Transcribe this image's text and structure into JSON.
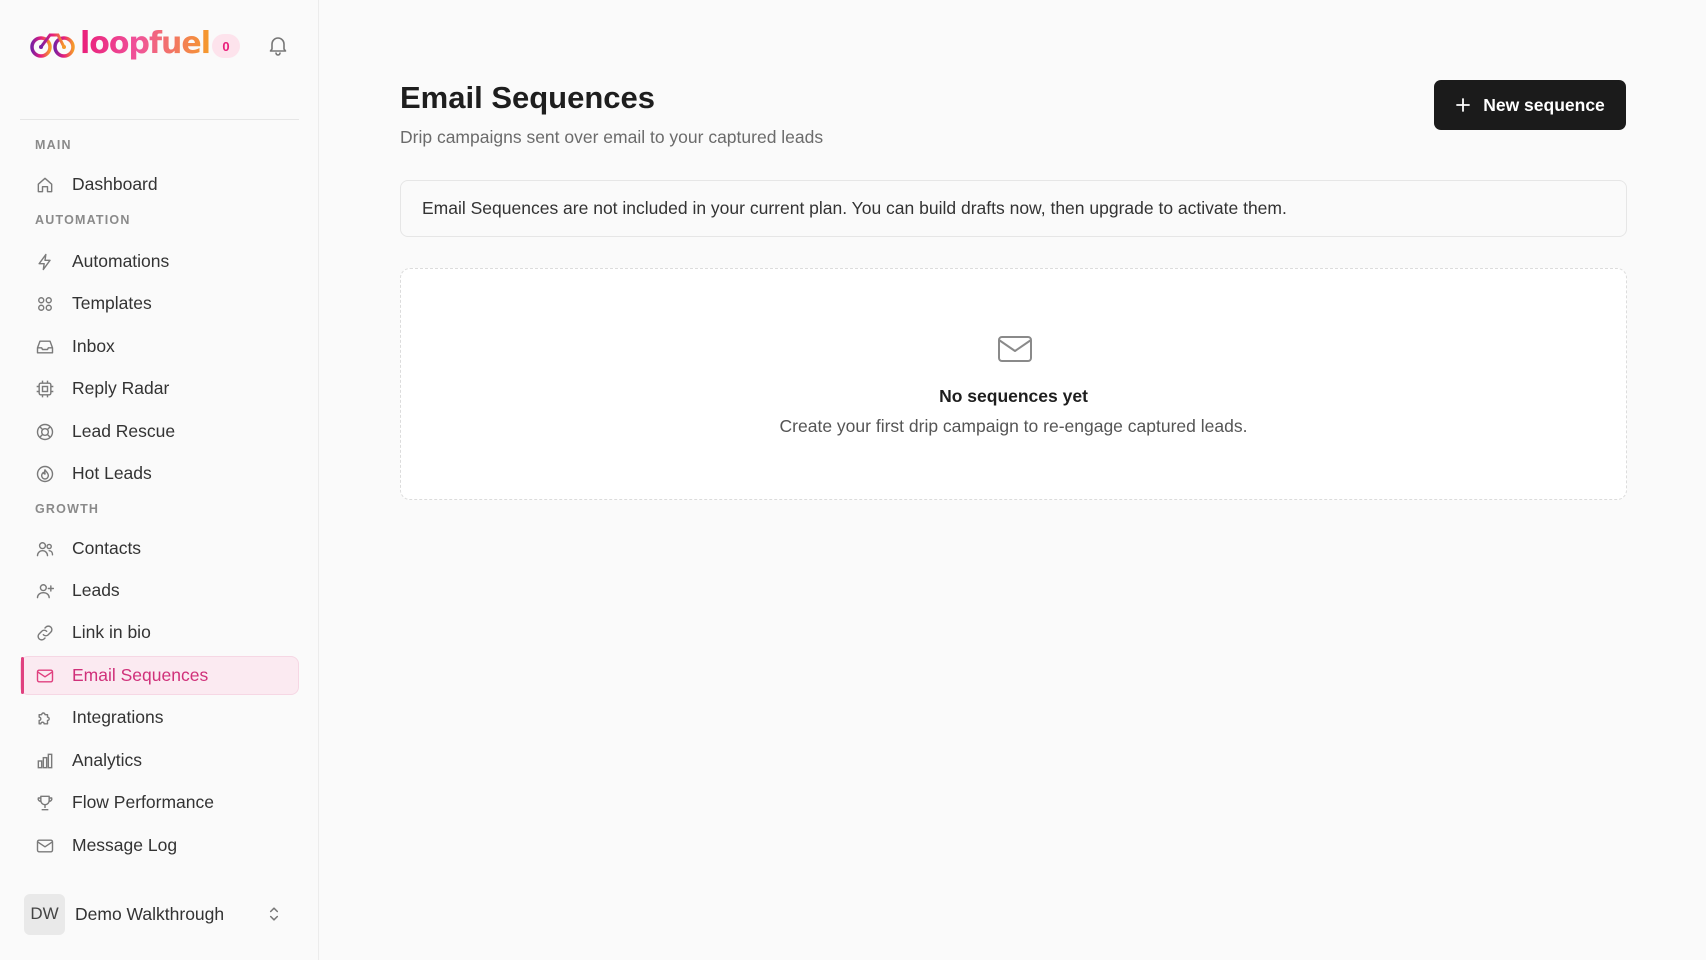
{
  "brand": {
    "name": "Loopfuel",
    "wordmark": "loopfuel",
    "notification_count": "0"
  },
  "sidebar": {
    "sections": {
      "main": "MAIN",
      "automation": "AUTOMATION",
      "growth": "GROWTH"
    },
    "items": [
      {
        "label": "Dashboard",
        "icon": "home-icon"
      },
      {
        "label": "Automations",
        "icon": "lightning-icon"
      },
      {
        "label": "Templates",
        "icon": "grid-icon"
      },
      {
        "label": "Inbox",
        "icon": "inbox-icon"
      },
      {
        "label": "Reply Radar",
        "icon": "radar-icon"
      },
      {
        "label": "Lead Rescue",
        "icon": "lifebuoy-icon"
      },
      {
        "label": "Hot Leads",
        "icon": "flame-icon"
      },
      {
        "label": "Contacts",
        "icon": "users-icon"
      },
      {
        "label": "Leads",
        "icon": "user-plus-icon"
      },
      {
        "label": "Link in bio",
        "icon": "link-icon"
      },
      {
        "label": "Email Sequences",
        "icon": "mail-icon",
        "active": true
      },
      {
        "label": "Integrations",
        "icon": "puzzle-icon"
      },
      {
        "label": "Analytics",
        "icon": "bar-chart-icon"
      },
      {
        "label": "Flow Performance",
        "icon": "trophy-icon"
      },
      {
        "label": "Message Log",
        "icon": "mail-icon"
      }
    ],
    "user": {
      "initials": "DW",
      "name": "Demo Walkthrough"
    }
  },
  "page": {
    "title": "Email Sequences",
    "subtitle": "Drip campaigns sent over email to your captured leads",
    "new_button": "New sequence",
    "notice": "Email Sequences are not included in your current plan. You can build drafts now, then upgrade to activate them.",
    "empty_title": "No sequences yet",
    "empty_desc": "Create your first drip campaign to re-engage captured leads."
  },
  "colors": {
    "accent": "#e0407f",
    "accent_bg": "#fbeaf1",
    "button_bg": "#1b1b1b",
    "background": "#fafafa"
  }
}
